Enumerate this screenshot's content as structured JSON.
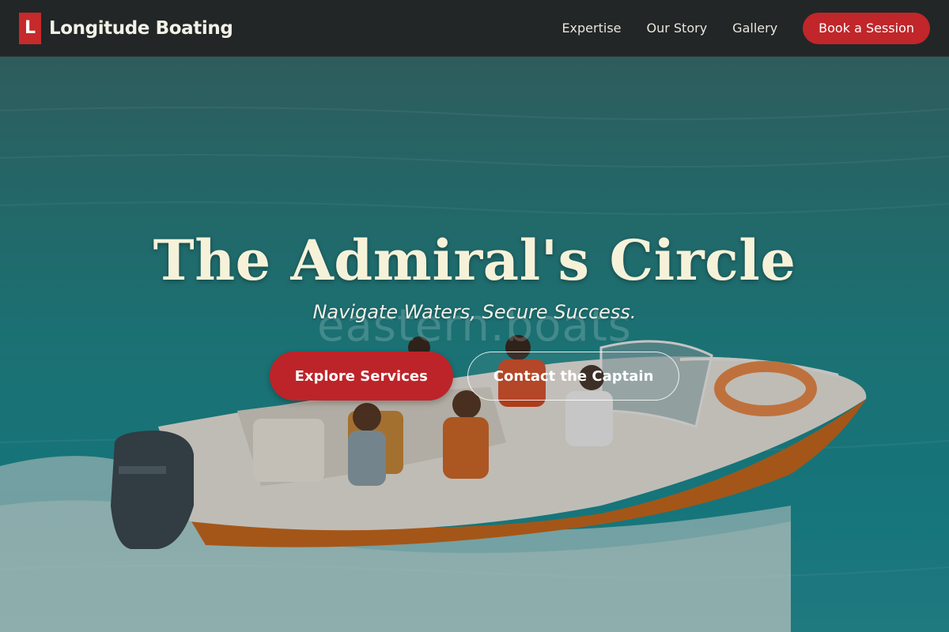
{
  "nav": {
    "logo_letter": "L",
    "brand_name": "Longitude Boating",
    "links": [
      {
        "label": "Expertise"
      },
      {
        "label": "Our Story"
      },
      {
        "label": "Gallery"
      }
    ],
    "cta_label": "Book a Session"
  },
  "hero": {
    "title": "The Admiral's Circle",
    "subtitle": "Navigate Waters, Secure Success.",
    "watermark": "eastern.boats",
    "primary_button": "Explore Services",
    "secondary_button": "Contact the Captain",
    "background_image": "speedboat-with-passengers-on-sea"
  },
  "colors": {
    "nav_background": "#222627",
    "accent_red": "#c0262a",
    "title_cream": "#f6f2d9",
    "sea_teal": "#218a8d"
  }
}
